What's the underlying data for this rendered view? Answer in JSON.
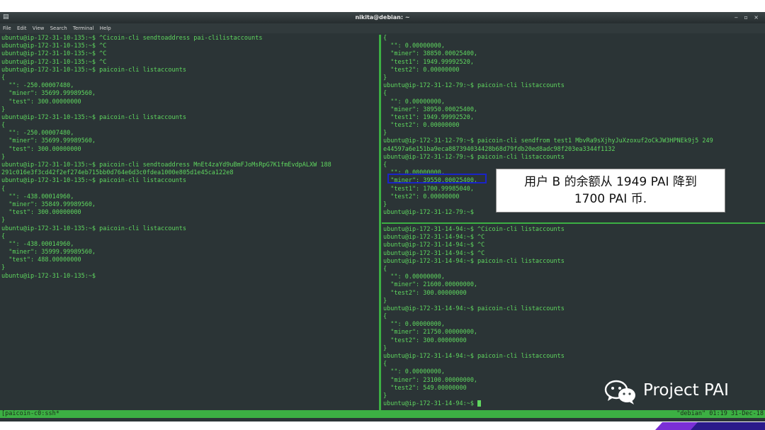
{
  "window": {
    "title": "nikita@debian: ~",
    "controls": "‒ ▫ ×",
    "menu": [
      "File",
      "Edit",
      "View",
      "Search",
      "Terminal",
      "Help"
    ]
  },
  "left_pane": {
    "lines": [
      "ubuntu@ip-172-31-10-135:~$ ^Cicoin-cli sendtoaddress pai-clilistaccounts",
      "ubuntu@ip-172-31-10-135:~$ ^C",
      "ubuntu@ip-172-31-10-135:~$ ^C",
      "ubuntu@ip-172-31-10-135:~$ ^C",
      "ubuntu@ip-172-31-10-135:~$ paicoin-cli listaccounts",
      "{",
      "  \"\": -250.00007480,",
      "  \"miner\": 35699.99989560,",
      "  \"test\": 300.00000000",
      "}",
      "ubuntu@ip-172-31-10-135:~$ paicoin-cli listaccounts",
      "{",
      "  \"\": -250.00007480,",
      "  \"miner\": 35699.99989560,",
      "  \"test\": 300.00000000",
      "}",
      "ubuntu@ip-172-31-10-135:~$ paicoin-cli sendtoaddress MnEt4zaYd9uBmFJoMsRpG7K1fmEvdpALXW 188",
      "291c016e3f3cd42f2ef274eb715bb0d764e6d3c0fdea1000e805d1e45ca122e8",
      "ubuntu@ip-172-31-10-135:~$ paicoin-cli listaccounts",
      "{",
      "  \"\": -438.00014960,",
      "  \"miner\": 35849.99989560,",
      "  \"test\": 300.00000000",
      "}",
      "ubuntu@ip-172-31-10-135:~$ paicoin-cli listaccounts",
      "{",
      "  \"\": -438.00014960,",
      "  \"miner\": 35999.99989560,",
      "  \"test\": 488.00000000",
      "}",
      "ubuntu@ip-172-31-10-135:~$"
    ]
  },
  "right_top_pane": {
    "lines": [
      "{",
      "  \"\": 0.00000000,",
      "  \"miner\": 38850.00025400,",
      "  \"test1\": 1949.99992520,",
      "  \"test2\": 0.00000000",
      "}",
      "ubuntu@ip-172-31-12-79:~$ paicoin-cli listaccounts",
      "{",
      "  \"\": 0.00000000,",
      "  \"miner\": 38950.00025400,",
      "  \"test1\": 1949.99992520,",
      "  \"test2\": 0.00000000",
      "}",
      "ubuntu@ip-172-31-12-79:~$ paicoin-cli sendfrom test1 MbvRa9sXjhyJuXzoxuf2oCkJW3HPNEk9j5 249",
      "e44597a6e151ba9eca887394034428b68d79fdb20ed8adc98f203ea3344f1132",
      "ubuntu@ip-172-31-12-79:~$ paicoin-cli listaccounts",
      "{",
      "  \"\": 0.00000000,",
      "  \"miner\": 39550.00025400,",
      "  \"test1\": 1700.99985040,",
      "  \"test2\": 0.00000000",
      "}",
      "ubuntu@ip-172-31-12-79:~$"
    ]
  },
  "right_bottom_pane": {
    "lines": [
      "ubuntu@ip-172-31-14-94:~$ ^Cicoin-cli listaccounts",
      "ubuntu@ip-172-31-14-94:~$ ^C",
      "ubuntu@ip-172-31-14-94:~$ ^C",
      "ubuntu@ip-172-31-14-94:~$ ^C",
      "ubuntu@ip-172-31-14-94:~$ paicoin-cli listaccounts",
      "{",
      "  \"\": 0.00000000,",
      "  \"miner\": 21600.00000000,",
      "  \"test2\": 300.00000000",
      "}",
      "ubuntu@ip-172-31-14-94:~$ paicoin-cli listaccounts",
      "{",
      "  \"\": 0.00000000,",
      "  \"miner\": 21750.00000000,",
      "  \"test2\": 300.00000000",
      "}",
      "ubuntu@ip-172-31-14-94:~$ paicoin-cli listaccounts",
      "{",
      "  \"\": 0.00000000,",
      "  \"miner\": 23100.00000000,",
      "  \"test2\": 549.00000000",
      "}",
      "ubuntu@ip-172-31-14-94:~$ "
    ]
  },
  "statusbar": {
    "left": "[paicoin-c0:ssh*",
    "right": "\"debian\" 01:19 31-Dec-18"
  },
  "callout": {
    "line1": "用户 B 的余额从 1949 PAI 降到",
    "line2": "1700 PAI 币."
  },
  "watermark": {
    "text": "Project PAI",
    "icon": "wechat-icon"
  },
  "colors": {
    "terminal_bg": "#2b3436",
    "terminal_text": "#5fd75f",
    "separator": "#3cb043",
    "highlight_box": "#1a23c8"
  }
}
